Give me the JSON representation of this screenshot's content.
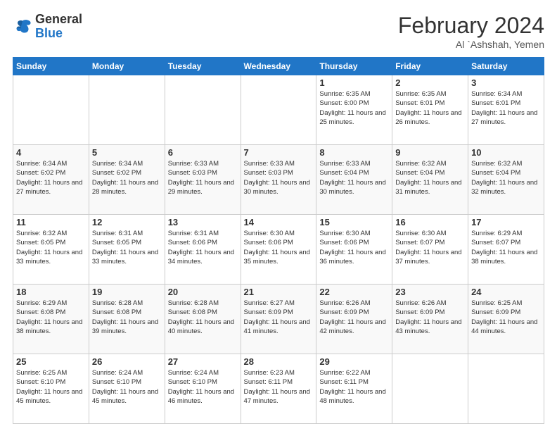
{
  "header": {
    "logo_general": "General",
    "logo_blue": "Blue",
    "title": "February 2024",
    "location": "Al `Ashshah, Yemen"
  },
  "days_of_week": [
    "Sunday",
    "Monday",
    "Tuesday",
    "Wednesday",
    "Thursday",
    "Friday",
    "Saturday"
  ],
  "weeks": [
    [
      {
        "day": "",
        "info": ""
      },
      {
        "day": "",
        "info": ""
      },
      {
        "day": "",
        "info": ""
      },
      {
        "day": "",
        "info": ""
      },
      {
        "day": "1",
        "info": "Sunrise: 6:35 AM\nSunset: 6:00 PM\nDaylight: 11 hours and 25 minutes."
      },
      {
        "day": "2",
        "info": "Sunrise: 6:35 AM\nSunset: 6:01 PM\nDaylight: 11 hours and 26 minutes."
      },
      {
        "day": "3",
        "info": "Sunrise: 6:34 AM\nSunset: 6:01 PM\nDaylight: 11 hours and 27 minutes."
      }
    ],
    [
      {
        "day": "4",
        "info": "Sunrise: 6:34 AM\nSunset: 6:02 PM\nDaylight: 11 hours and 27 minutes."
      },
      {
        "day": "5",
        "info": "Sunrise: 6:34 AM\nSunset: 6:02 PM\nDaylight: 11 hours and 28 minutes."
      },
      {
        "day": "6",
        "info": "Sunrise: 6:33 AM\nSunset: 6:03 PM\nDaylight: 11 hours and 29 minutes."
      },
      {
        "day": "7",
        "info": "Sunrise: 6:33 AM\nSunset: 6:03 PM\nDaylight: 11 hours and 30 minutes."
      },
      {
        "day": "8",
        "info": "Sunrise: 6:33 AM\nSunset: 6:04 PM\nDaylight: 11 hours and 30 minutes."
      },
      {
        "day": "9",
        "info": "Sunrise: 6:32 AM\nSunset: 6:04 PM\nDaylight: 11 hours and 31 minutes."
      },
      {
        "day": "10",
        "info": "Sunrise: 6:32 AM\nSunset: 6:04 PM\nDaylight: 11 hours and 32 minutes."
      }
    ],
    [
      {
        "day": "11",
        "info": "Sunrise: 6:32 AM\nSunset: 6:05 PM\nDaylight: 11 hours and 33 minutes."
      },
      {
        "day": "12",
        "info": "Sunrise: 6:31 AM\nSunset: 6:05 PM\nDaylight: 11 hours and 33 minutes."
      },
      {
        "day": "13",
        "info": "Sunrise: 6:31 AM\nSunset: 6:06 PM\nDaylight: 11 hours and 34 minutes."
      },
      {
        "day": "14",
        "info": "Sunrise: 6:30 AM\nSunset: 6:06 PM\nDaylight: 11 hours and 35 minutes."
      },
      {
        "day": "15",
        "info": "Sunrise: 6:30 AM\nSunset: 6:06 PM\nDaylight: 11 hours and 36 minutes."
      },
      {
        "day": "16",
        "info": "Sunrise: 6:30 AM\nSunset: 6:07 PM\nDaylight: 11 hours and 37 minutes."
      },
      {
        "day": "17",
        "info": "Sunrise: 6:29 AM\nSunset: 6:07 PM\nDaylight: 11 hours and 38 minutes."
      }
    ],
    [
      {
        "day": "18",
        "info": "Sunrise: 6:29 AM\nSunset: 6:08 PM\nDaylight: 11 hours and 38 minutes."
      },
      {
        "day": "19",
        "info": "Sunrise: 6:28 AM\nSunset: 6:08 PM\nDaylight: 11 hours and 39 minutes."
      },
      {
        "day": "20",
        "info": "Sunrise: 6:28 AM\nSunset: 6:08 PM\nDaylight: 11 hours and 40 minutes."
      },
      {
        "day": "21",
        "info": "Sunrise: 6:27 AM\nSunset: 6:09 PM\nDaylight: 11 hours and 41 minutes."
      },
      {
        "day": "22",
        "info": "Sunrise: 6:26 AM\nSunset: 6:09 PM\nDaylight: 11 hours and 42 minutes."
      },
      {
        "day": "23",
        "info": "Sunrise: 6:26 AM\nSunset: 6:09 PM\nDaylight: 11 hours and 43 minutes."
      },
      {
        "day": "24",
        "info": "Sunrise: 6:25 AM\nSunset: 6:09 PM\nDaylight: 11 hours and 44 minutes."
      }
    ],
    [
      {
        "day": "25",
        "info": "Sunrise: 6:25 AM\nSunset: 6:10 PM\nDaylight: 11 hours and 45 minutes."
      },
      {
        "day": "26",
        "info": "Sunrise: 6:24 AM\nSunset: 6:10 PM\nDaylight: 11 hours and 45 minutes."
      },
      {
        "day": "27",
        "info": "Sunrise: 6:24 AM\nSunset: 6:10 PM\nDaylight: 11 hours and 46 minutes."
      },
      {
        "day": "28",
        "info": "Sunrise: 6:23 AM\nSunset: 6:11 PM\nDaylight: 11 hours and 47 minutes."
      },
      {
        "day": "29",
        "info": "Sunrise: 6:22 AM\nSunset: 6:11 PM\nDaylight: 11 hours and 48 minutes."
      },
      {
        "day": "",
        "info": ""
      },
      {
        "day": "",
        "info": ""
      }
    ]
  ]
}
